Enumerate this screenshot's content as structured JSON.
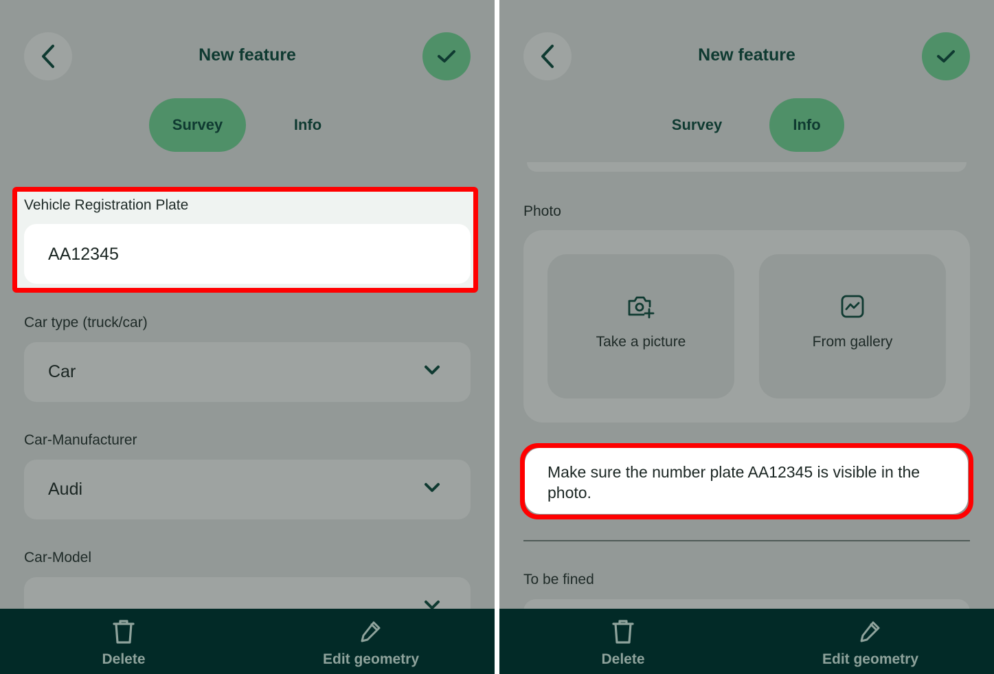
{
  "left": {
    "title": "New feature",
    "tabs": [
      {
        "label": "Survey",
        "active": true
      },
      {
        "label": "Info",
        "active": false
      }
    ],
    "fields": [
      {
        "label": "Vehicle Registration Plate",
        "value": "AA12345",
        "type": "text",
        "highlighted": true
      },
      {
        "label": "Car type (truck/car)",
        "value": "Car",
        "type": "select"
      },
      {
        "label": "Car-Manufacturer",
        "value": "Audi",
        "type": "select"
      },
      {
        "label": "Car-Model",
        "value": "",
        "type": "select"
      }
    ],
    "bottom_bar": {
      "delete_label": "Delete",
      "edit_label": "Edit geometry"
    }
  },
  "right": {
    "title": "New feature",
    "tabs": [
      {
        "label": "Survey",
        "active": false
      },
      {
        "label": "Info",
        "active": true
      }
    ],
    "photo": {
      "label": "Photo",
      "take_label": "Take a picture",
      "gallery_label": "From gallery",
      "hint": "Make sure the number plate AA12345 is visible in the photo."
    },
    "fined_label": "To be fined",
    "bottom_bar": {
      "delete_label": "Delete",
      "edit_label": "Edit geometry"
    }
  },
  "colors": {
    "accent": "#4f9068",
    "dark_text": "#0f3a31",
    "bottom_bar": "#022a27",
    "highlight": "#ff0000",
    "overlay": "#939997"
  },
  "icons": [
    "back-arrow-icon",
    "check-icon",
    "chevron-down-icon",
    "camera-plus-icon",
    "gallery-icon",
    "trash-icon",
    "pencil-icon"
  ]
}
